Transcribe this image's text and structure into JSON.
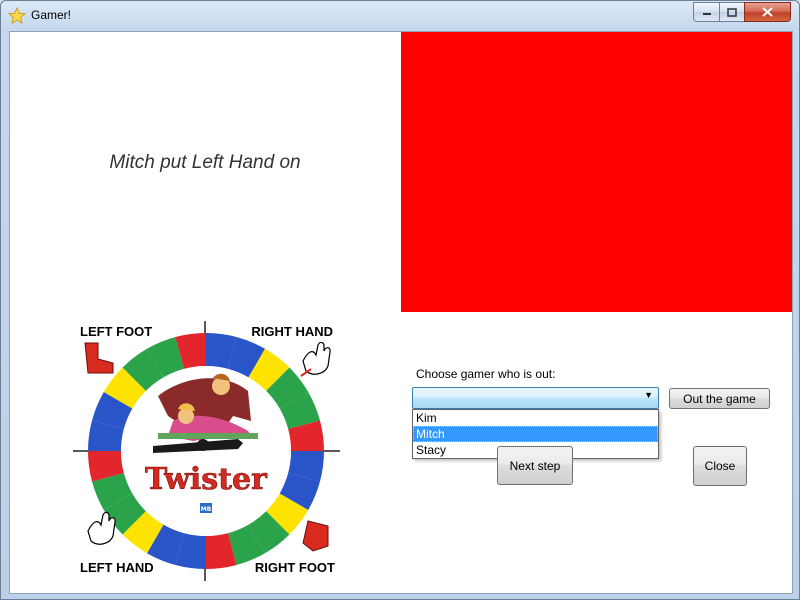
{
  "window": {
    "title": "Gamer!",
    "icon": "star-icon"
  },
  "main": {
    "prompt": "Mitch put Left Hand on",
    "color_panel_color": "#ff0000"
  },
  "spinner": {
    "brand": "Twister",
    "corners": {
      "top_left": "LEFT FOOT",
      "top_right": "RIGHT HAND",
      "bottom_left": "LEFT HAND",
      "bottom_right": "RIGHT FOOT"
    },
    "logo": "MB"
  },
  "out_panel": {
    "choose_label": "Choose gamer who is out:",
    "selected_value": "",
    "options": [
      "Kim",
      "Mitch",
      "Stacy"
    ],
    "highlighted_option": "Mitch",
    "out_button": "Out the game"
  },
  "buttons": {
    "next_step": "Next step",
    "close": "Close"
  }
}
